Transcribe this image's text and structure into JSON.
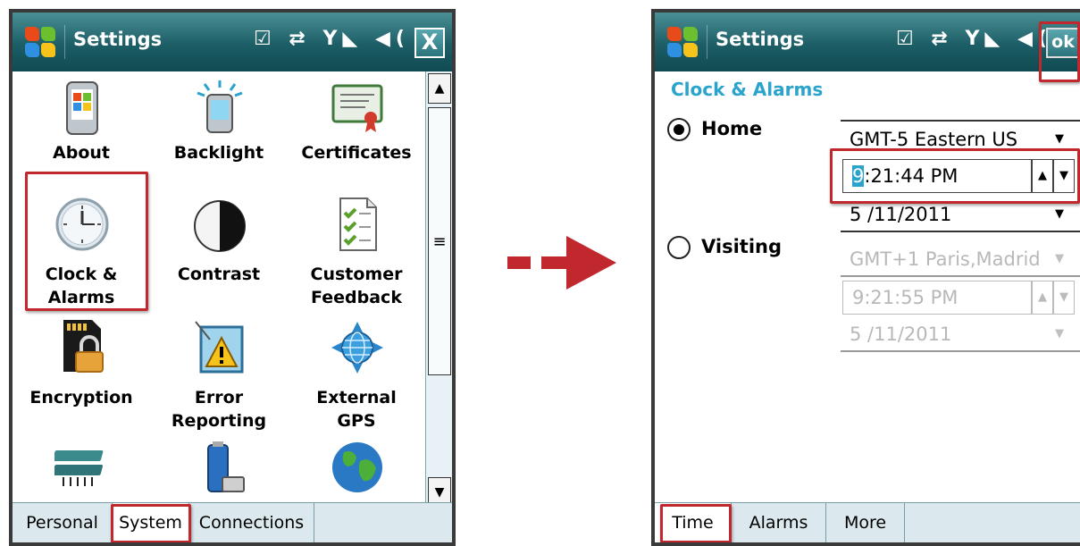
{
  "left": {
    "title": "Settings",
    "status_icons": "☑ ⇄ Y◣ ◀(",
    "close_label": "X",
    "grid_items": [
      {
        "label": "About"
      },
      {
        "label": "Backlight"
      },
      {
        "label": "Certificates"
      },
      {
        "label": "Clock &\nAlarms"
      },
      {
        "label": "Contrast"
      },
      {
        "label": "Customer\nFeedback"
      },
      {
        "label": "Encryption"
      },
      {
        "label": "Error\nReporting"
      },
      {
        "label": "External\nGPS"
      }
    ],
    "tabs": [
      {
        "label": "Personal"
      },
      {
        "label": "System"
      },
      {
        "label": "Connections"
      }
    ]
  },
  "right": {
    "title": "Settings",
    "status_icons": "☑ ⇄ Y◣ ◀(",
    "ok_label": "ok",
    "heading": "Clock & Alarms",
    "home": {
      "label": "Home",
      "timezone": "GMT-5 Eastern US",
      "time_caret": "9",
      "time_rest": ":21:44 PM",
      "date": "5 /11/2011"
    },
    "visiting": {
      "label": "Visiting",
      "timezone": "GMT+1 Paris,Madrid",
      "time": "9:21:55 PM",
      "date": "5 /11/2011"
    },
    "tabs": [
      {
        "label": "Time"
      },
      {
        "label": "Alarms"
      },
      {
        "label": "More"
      }
    ]
  },
  "colors": {
    "title_bar": "#1d5e66",
    "highlight": "#c0282d",
    "heading": "#2aa3cd",
    "tab_bar": "#dbe9ee"
  }
}
